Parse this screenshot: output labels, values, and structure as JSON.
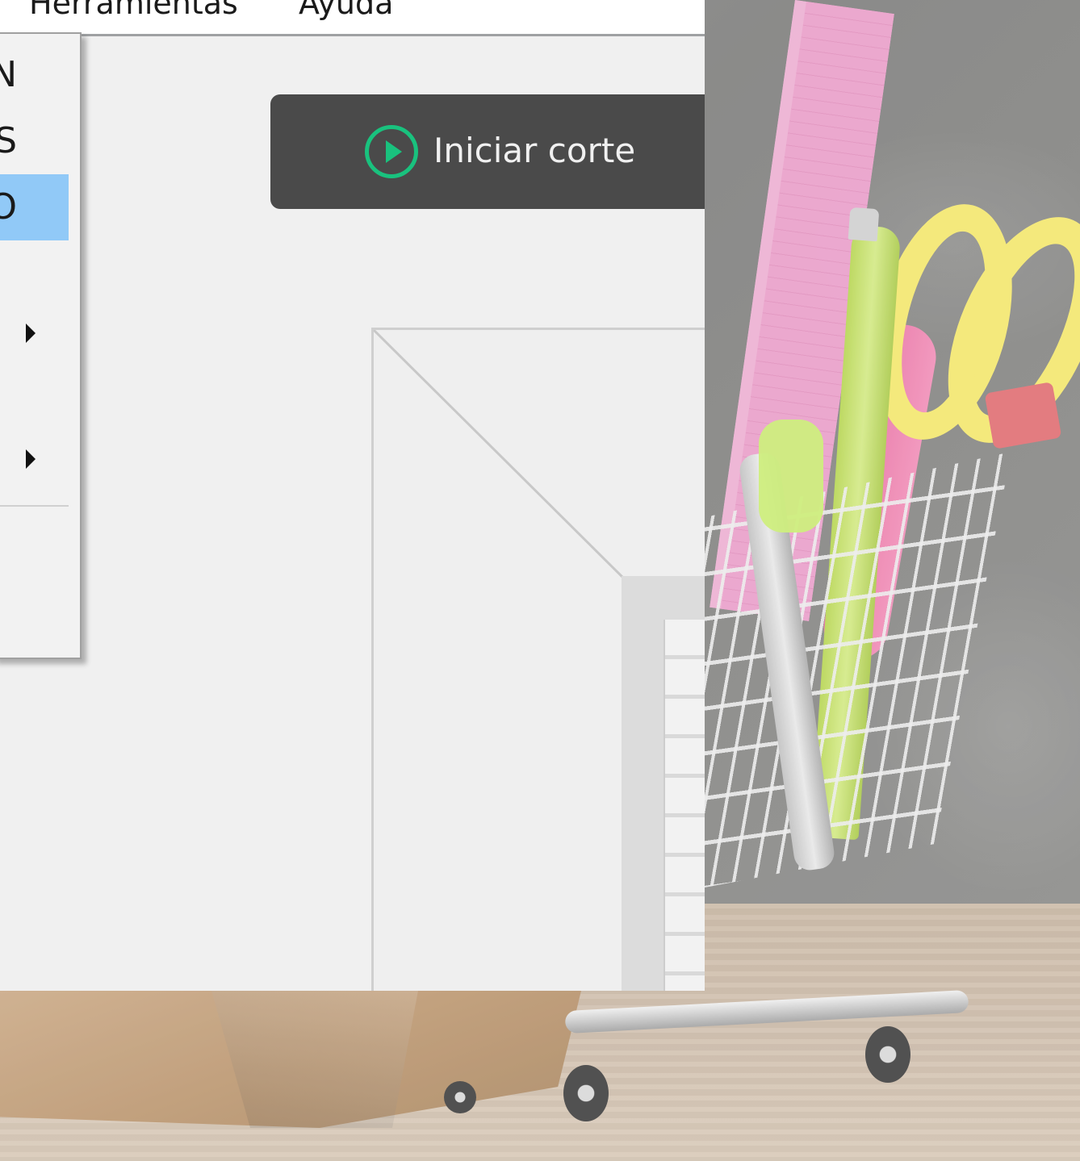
{
  "menubar": {
    "items": [
      {
        "label": "Herramientas"
      },
      {
        "label": "Ayuda"
      }
    ]
  },
  "dropdown": {
    "items": [
      {
        "label": "N",
        "selected": false
      },
      {
        "label": "S",
        "selected": false
      },
      {
        "label": "O",
        "selected": true
      },
      {
        "label": "",
        "has_submenu": true
      },
      {
        "label": "",
        "has_submenu": true
      }
    ]
  },
  "toolbar": {
    "start_label": "Iniciar corte",
    "start_icon": "play-circle-icon",
    "accent_color": "#19c27e",
    "button_color": "#4a4a4a"
  }
}
